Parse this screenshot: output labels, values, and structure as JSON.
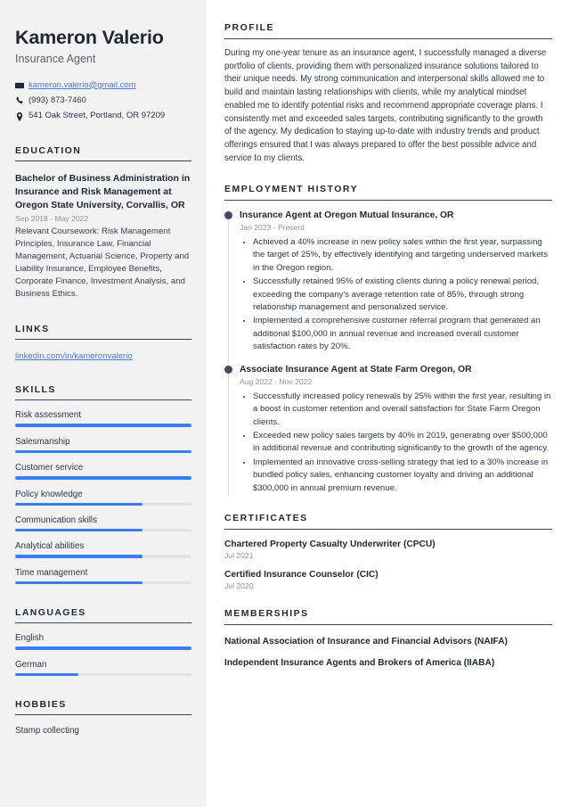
{
  "theme": {
    "sidebar_bg": "#f2f2f2",
    "accent_bar": "#3b7df4",
    "link": "#4f78d8",
    "heading": "#222833",
    "muted": "#8d939e"
  },
  "header": {
    "name": "Kameron Valerio",
    "job_title": "Insurance Agent",
    "contacts": [
      {
        "icon": "envelope-icon",
        "text": "kameron.valerio@gmail.com",
        "is_link": true
      },
      {
        "icon": "phone-icon",
        "text": "(993) 873-7460",
        "is_link": false
      },
      {
        "icon": "location-pin-icon",
        "text": "541 Oak Street, Portland, OR 97209",
        "is_link": false
      }
    ]
  },
  "sidebar": {
    "education": {
      "heading": "EDUCATION",
      "entries": [
        {
          "title": "Bachelor of Business Administration in Insurance and Risk Management at Oregon State University, Corvallis, OR",
          "date": "Sep 2018 - May 2022",
          "description": "Relevant Coursework: Risk Management Principles, Insurance Law, Financial Management, Actuarial Science, Property and Liability Insurance, Employee Benefits, Corporate Finance, Investment Analysis, and Business Ethics."
        }
      ]
    },
    "links": {
      "heading": "LINKS",
      "items": [
        {
          "label": "linkedin.com/in/kameronvalerio"
        }
      ]
    },
    "skills": {
      "heading": "SKILLS",
      "items": [
        {
          "label": "Risk assessment",
          "level": 100
        },
        {
          "label": "Salesmanship",
          "level": 100
        },
        {
          "label": "Customer service",
          "level": 100
        },
        {
          "label": "Policy knowledge",
          "level": 72
        },
        {
          "label": "Communication skills",
          "level": 72
        },
        {
          "label": "Analytical abilities",
          "level": 72
        },
        {
          "label": "Time management",
          "level": 72
        }
      ]
    },
    "languages": {
      "heading": "LANGUAGES",
      "items": [
        {
          "label": "English",
          "level": 100
        },
        {
          "label": "German",
          "level": 36
        }
      ]
    },
    "hobbies": {
      "heading": "HOBBIES",
      "items": [
        {
          "label": "Stamp collecting"
        }
      ]
    }
  },
  "main": {
    "profile": {
      "heading": "PROFILE",
      "text": "During my one-year tenure as an insurance agent, I successfully managed a diverse portfolio of clients, providing them with personalized insurance solutions tailored to their unique needs. My strong communication and interpersonal skills allowed me to build and maintain lasting relationships with clients, while my analytical mindset enabled me to identify potential risks and recommend appropriate coverage plans. I consistently met and exceeded sales targets, contributing significantly to the growth of the agency. My dedication to staying up-to-date with industry trends and product offerings ensured that I was always prepared to offer the best possible advice and service to my clients."
    },
    "employment": {
      "heading": "EMPLOYMENT HISTORY",
      "entries": [
        {
          "title": "Insurance Agent at Oregon Mutual Insurance, OR",
          "date": "Jan 2023 - Present",
          "bullets": [
            "Achieved a 40% increase in new policy sales within the first year, surpassing the target of 25%, by effectively identifying and targeting underserved markets in the Oregon region.",
            "Successfully retained 95% of existing clients during a policy renewal period, exceeding the company's average retention rate of 85%, through strong relationship management and personalized service.",
            "Implemented a comprehensive customer referral program that generated an additional $100,000 in annual revenue and increased overall customer satisfaction rates by 20%."
          ]
        },
        {
          "title": "Associate Insurance Agent at State Farm Oregon, OR",
          "date": "Aug 2022 - Nov 2022",
          "bullets": [
            "Successfully increased policy renewals by 25% within the first year, resulting in a boost in customer retention and overall satisfaction for State Farm Oregon clients.",
            "Exceeded new policy sales targets by 40% in 2019, generating over $500,000 in additional revenue and contributing significantly to the growth of the agency.",
            "Implemented an innovative cross-selling strategy that led to a 30% increase in bundled policy sales, enhancing customer loyalty and driving an additional $300,000 in annual premium revenue."
          ]
        }
      ]
    },
    "certificates": {
      "heading": "CERTIFICATES",
      "items": [
        {
          "name": "Chartered Property Casualty Underwriter (CPCU)",
          "date": "Jul 2021"
        },
        {
          "name": "Certified Insurance Counselor (CIC)",
          "date": "Jul 2020"
        }
      ]
    },
    "memberships": {
      "heading": "MEMBERSHIPS",
      "items": [
        {
          "name": "National Association of Insurance and Financial Advisors (NAIFA)"
        },
        {
          "name": "Independent Insurance Agents and Brokers of America (IIABA)"
        }
      ]
    }
  }
}
